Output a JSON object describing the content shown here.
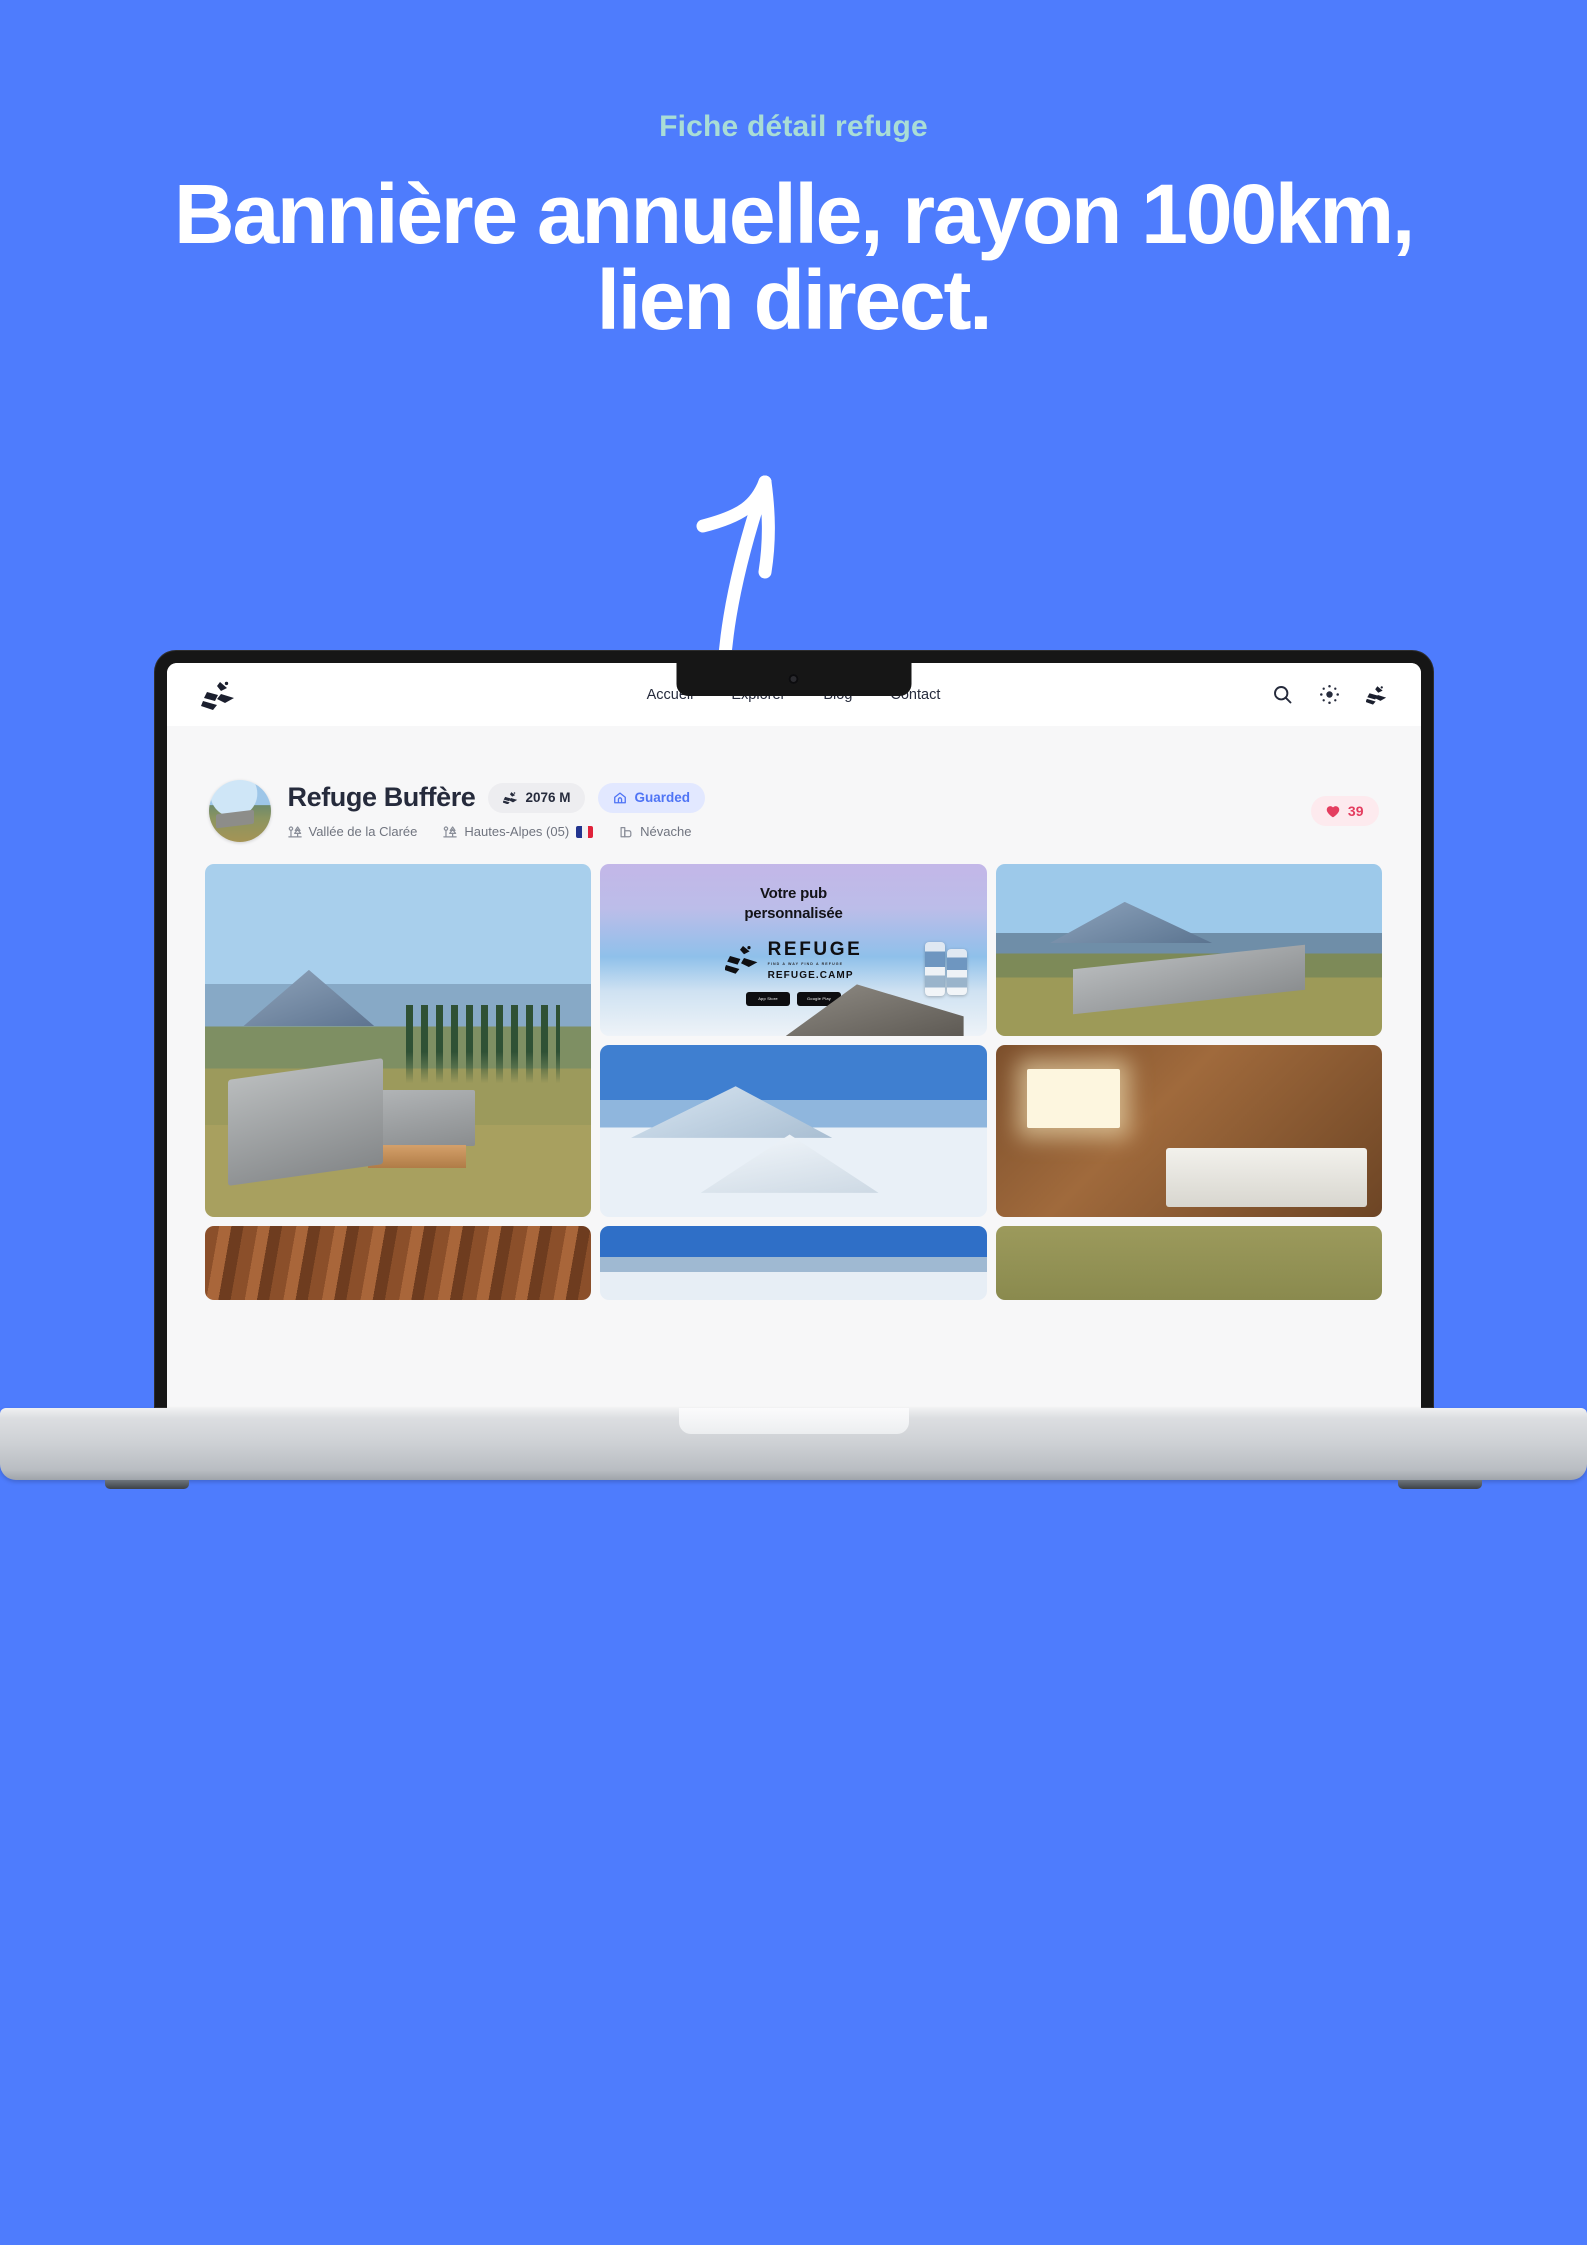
{
  "promo": {
    "eyebrow": "Fiche détail refuge",
    "title": "Bannière annuelle, rayon 100km, lien direct."
  },
  "colors": {
    "background": "#4e7cfd",
    "eyebrow": "#a9ddd6",
    "heading": "#ffffff",
    "accent": "#4f74f5",
    "like": "#e43d5f",
    "text_dark": "#262b3c",
    "text_muted": "#70747f"
  },
  "site": {
    "nav": {
      "logo_icon": "refuge-mountain-logo",
      "links": [
        {
          "label": "Accueil"
        },
        {
          "label": "Explorer"
        },
        {
          "label": "Blog"
        },
        {
          "label": "Contact"
        }
      ],
      "icons": [
        {
          "name": "search-icon"
        },
        {
          "name": "brightness-sun-icon"
        },
        {
          "name": "refuge-mountain-logo"
        }
      ]
    },
    "refuge": {
      "avatar_alt": "refuge-thumbnail",
      "name": "Refuge Buffère",
      "altitude_badge": {
        "icon": "mountain-icon",
        "label": "2076 M"
      },
      "status_badge": {
        "icon": "hut-icon",
        "label": "Guarded"
      },
      "meta": [
        {
          "icon": "valley-trees-icon",
          "label": "Vallée de la Clarée"
        },
        {
          "icon": "valley-trees-icon",
          "label": "Hautes-Alpes (05)",
          "flag": "fr"
        },
        {
          "icon": "building-icon",
          "label": "Névache"
        }
      ],
      "likes": {
        "icon": "heart-icon",
        "count": "39"
      }
    },
    "gallery": {
      "items": [
        {
          "name": "photo-village-main",
          "kind": "photo",
          "style": "ph-village"
        },
        {
          "name": "ad-banner",
          "kind": "ad"
        },
        {
          "name": "photo-alpine-huts",
          "kind": "photo",
          "style": "ph-alp"
        },
        {
          "name": "photo-snow-refuge",
          "kind": "photo",
          "style": "ph-snow"
        },
        {
          "name": "photo-bunk-room",
          "kind": "photo",
          "style": "ph-bunk"
        }
      ],
      "second_row": [
        {
          "name": "photo-wood-interior",
          "style": "ph-wood"
        },
        {
          "name": "photo-mountain-sky",
          "style": "ph-sky"
        },
        {
          "name": "photo-meadow",
          "style": "ph-grass"
        }
      ]
    },
    "ad": {
      "title_line1": "Votre pub",
      "title_line2": "personnalisée",
      "brand_word": "REFUGE",
      "brand_tagline": "FIND A WAY FIND A REFUGE",
      "brand_url": "REFUGE.CAMP",
      "stores": [
        {
          "label": "App Store"
        },
        {
          "label": "Google Play"
        }
      ]
    }
  }
}
